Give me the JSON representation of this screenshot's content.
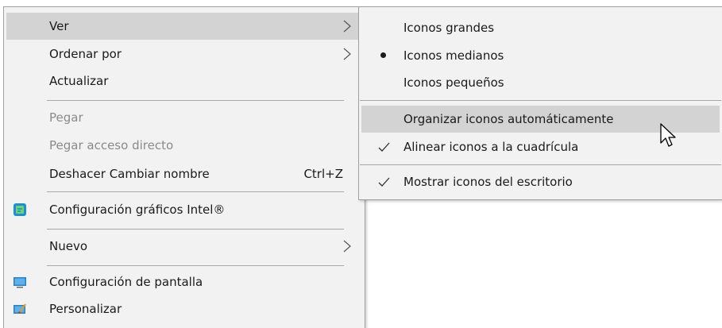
{
  "context_menu": {
    "items": [
      {
        "label": "Ver",
        "has_submenu": true,
        "active": true
      },
      {
        "label": "Ordenar por",
        "has_submenu": true
      },
      {
        "label": "Actualizar"
      },
      {
        "label": "Pegar",
        "disabled": true
      },
      {
        "label": "Pegar acceso directo",
        "disabled": true
      },
      {
        "label": "Deshacer Cambiar nombre",
        "shortcut": "Ctrl+Z"
      },
      {
        "label": "Configuración gráficos Intel®",
        "icon": "intel-graphics-icon"
      },
      {
        "label": "Nuevo",
        "has_submenu": true
      },
      {
        "label": "Configuración de pantalla",
        "icon": "display-icon"
      },
      {
        "label": "Personalizar",
        "icon": "personalize-icon"
      }
    ]
  },
  "submenu_ver": {
    "items": [
      {
        "label": "Iconos grandes"
      },
      {
        "label": "Iconos medianos",
        "marker": "bullet"
      },
      {
        "label": "Iconos pequeños"
      },
      {
        "label": "Organizar iconos automáticamente",
        "highlighted": true
      },
      {
        "label": "Alinear iconos a la cuadrícula",
        "marker": "check"
      },
      {
        "label": "Mostrar iconos del escritorio",
        "marker": "check"
      }
    ]
  },
  "colors": {
    "menu_background": "#f2f2f2",
    "highlight": "#d3d3d3",
    "disabled_text": "#8a8a8a",
    "separator": "#a8a8a8"
  }
}
